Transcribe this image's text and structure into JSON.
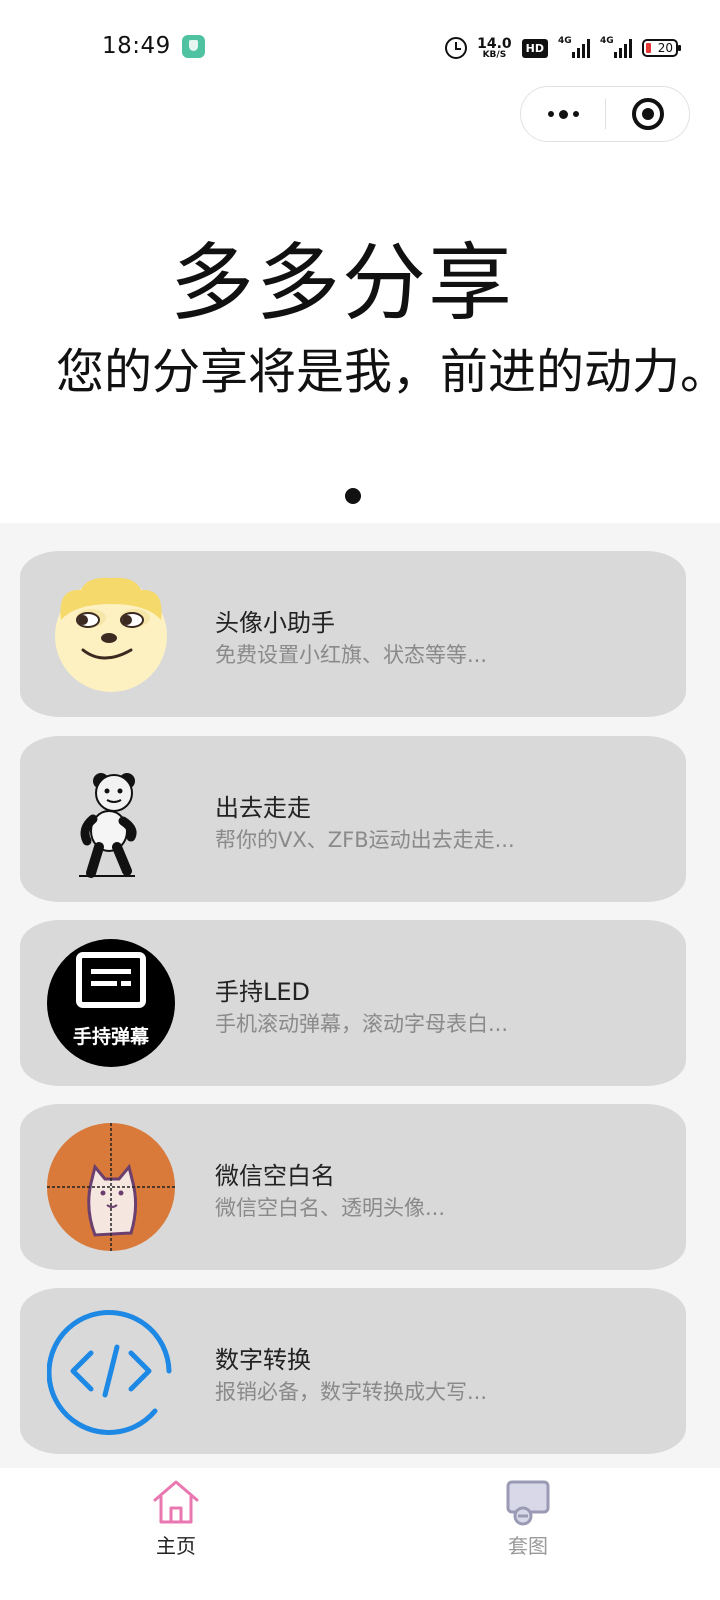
{
  "status_bar": {
    "time": "18:49",
    "net_speed_value": "14.0",
    "net_speed_unit": "KB/S",
    "hd_badge": "HD",
    "signal_1_tag": "4G",
    "signal_2_tag": "4G",
    "battery_level": "20"
  },
  "capsule": {
    "more_icon": "more-dots-icon",
    "close_icon": "target-close-icon"
  },
  "banner": {
    "title": "多多分享",
    "subtitle": "您的分享将是我，前进的动力。",
    "active_page": 1,
    "page_count": 1
  },
  "tools": [
    {
      "title": "头像小助手",
      "desc": "免费设置小红旗、状态等等...",
      "icon": "doge-avatar-icon"
    },
    {
      "title": "出去走走",
      "desc": "帮你的VX、ZFB运动出去走走...",
      "icon": "panda-walking-icon"
    },
    {
      "title": "手持LED",
      "desc": "手机滚动弹幕，滚动字母表白...",
      "icon": "led-danmaku-icon",
      "icon_text": "手持弹幕"
    },
    {
      "title": "微信空白名",
      "desc": "微信空白名、透明头像...",
      "icon": "crosshair-cat-icon"
    },
    {
      "title": "数字转换",
      "desc": "报销必备，数字转换成大写...",
      "icon": "code-brackets-icon"
    }
  ],
  "tabbar": {
    "items": [
      {
        "label": "主页",
        "icon": "home-icon",
        "active": true
      },
      {
        "label": "套图",
        "icon": "gallery-icon",
        "active": false
      }
    ]
  },
  "colors": {
    "card_bg": "#d9d9d9",
    "list_bg": "#f5f5f5",
    "home_icon_active": "#e977b0",
    "code_icon_blue": "#1e88e5",
    "cat_icon_orange": "#d9793a"
  }
}
